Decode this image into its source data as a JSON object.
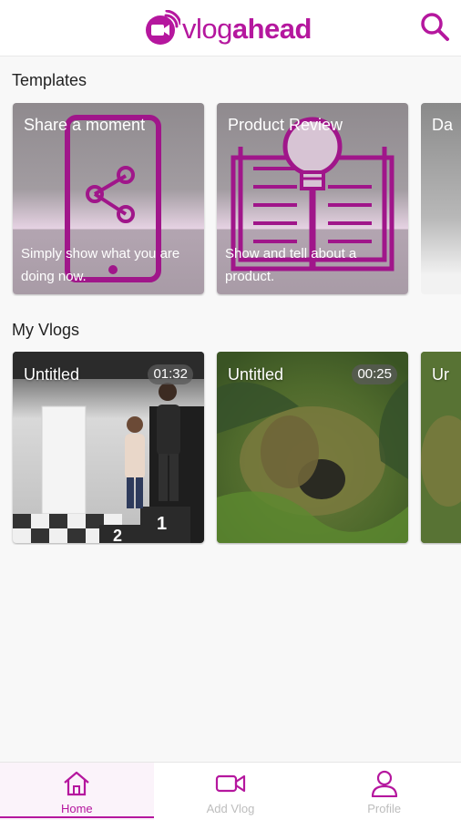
{
  "colors": {
    "accent": "#b5179e",
    "inactive": "#bdbdbd"
  },
  "header": {
    "logo_prefix": "vlog",
    "logo_suffix": "ahead",
    "logo_icon": "camera-signal-icon",
    "search_icon": "search-icon"
  },
  "templates": {
    "title": "Templates",
    "items": [
      {
        "title": "Share a moment",
        "description": "Simply show what you are doing now.",
        "icon": "share-phone-icon"
      },
      {
        "title": "Product Review",
        "description": "Show and tell about a product.",
        "icon": "lightbulb-book-icon"
      },
      {
        "title": "Da",
        "description": "",
        "icon": ""
      }
    ]
  },
  "vlogs": {
    "title": "My Vlogs",
    "items": [
      {
        "title": "Untitled",
        "duration": "01:32"
      },
      {
        "title": "Untitled",
        "duration": "00:25"
      },
      {
        "title": "Ur",
        "duration": ""
      }
    ]
  },
  "nav": {
    "items": [
      {
        "label": "Home",
        "icon": "home-icon",
        "active": true
      },
      {
        "label": "Add Vlog",
        "icon": "video-camera-icon",
        "active": false
      },
      {
        "label": "Profile",
        "icon": "user-icon",
        "active": false
      }
    ]
  }
}
